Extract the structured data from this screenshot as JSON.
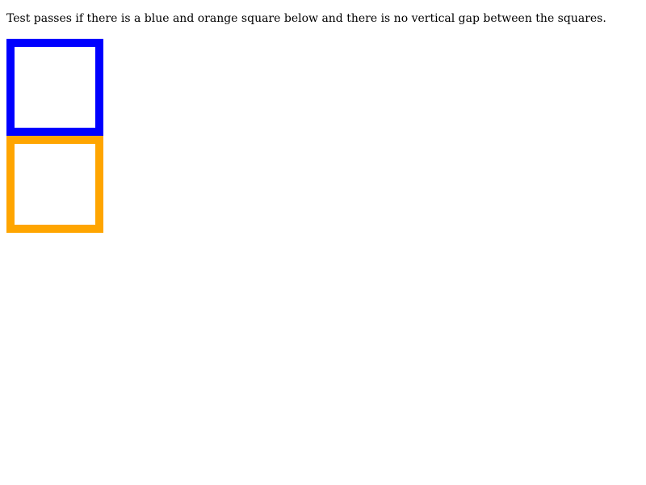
{
  "instruction": {
    "text": "Test passes if there is a blue and orange square below and there is no vertical gap between the squares."
  },
  "colors": {
    "top_square_border": "#0000ff",
    "bottom_square_border": "#ffa500",
    "background": "#ffffff",
    "text": "#000000"
  }
}
